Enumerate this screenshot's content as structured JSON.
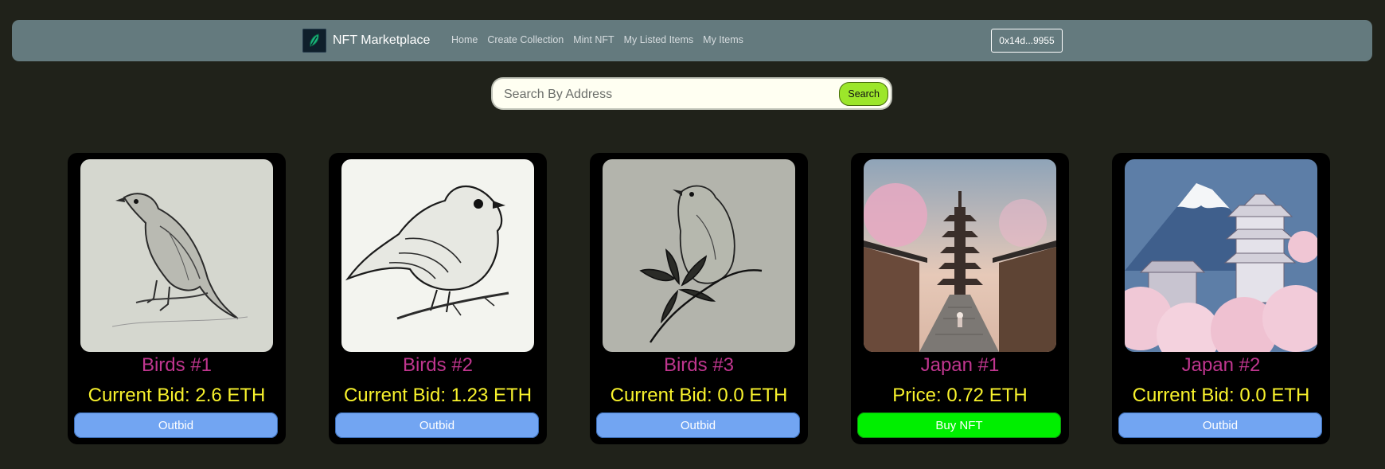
{
  "header": {
    "brand_name": "NFT Marketplace",
    "logo_icon": "leaf-icon",
    "nav": [
      "Home",
      "Create Collection",
      "Mint NFT",
      "My Listed Items",
      "My Items"
    ],
    "wallet": "0x14d...9955"
  },
  "search": {
    "placeholder": "Search By Address",
    "value": "",
    "button": "Search"
  },
  "cards": [
    {
      "title": "Birds #1",
      "price": "Current Bid: 2.6 ETH",
      "button": "Outbid",
      "image": "bird-sketch-image"
    },
    {
      "title": "Birds #2",
      "price": "Current Bid: 1.23 ETH",
      "button": "Outbid",
      "image": "bird-sketch-image"
    },
    {
      "title": "Birds #3",
      "price": "Current Bid: 0.0 ETH",
      "button": "Outbid",
      "image": "bird-sketch-image"
    },
    {
      "title": "Japan #1",
      "price": "Price: 0.72 ETH",
      "button": "Buy NFT",
      "image": "japan-street-image"
    },
    {
      "title": "Japan #2",
      "price": "Current Bid: 0.0 ETH",
      "button": "Outbid",
      "image": "japan-castle-image"
    }
  ],
  "colors": {
    "background": "#20221a",
    "navbar": "#647a7e",
    "card": "#000000",
    "title": "#c0368f",
    "price": "#f8f22c",
    "outbid_button": "#72a5f2",
    "buy_button": "#00ef00",
    "search_button": "#9ce62a"
  }
}
